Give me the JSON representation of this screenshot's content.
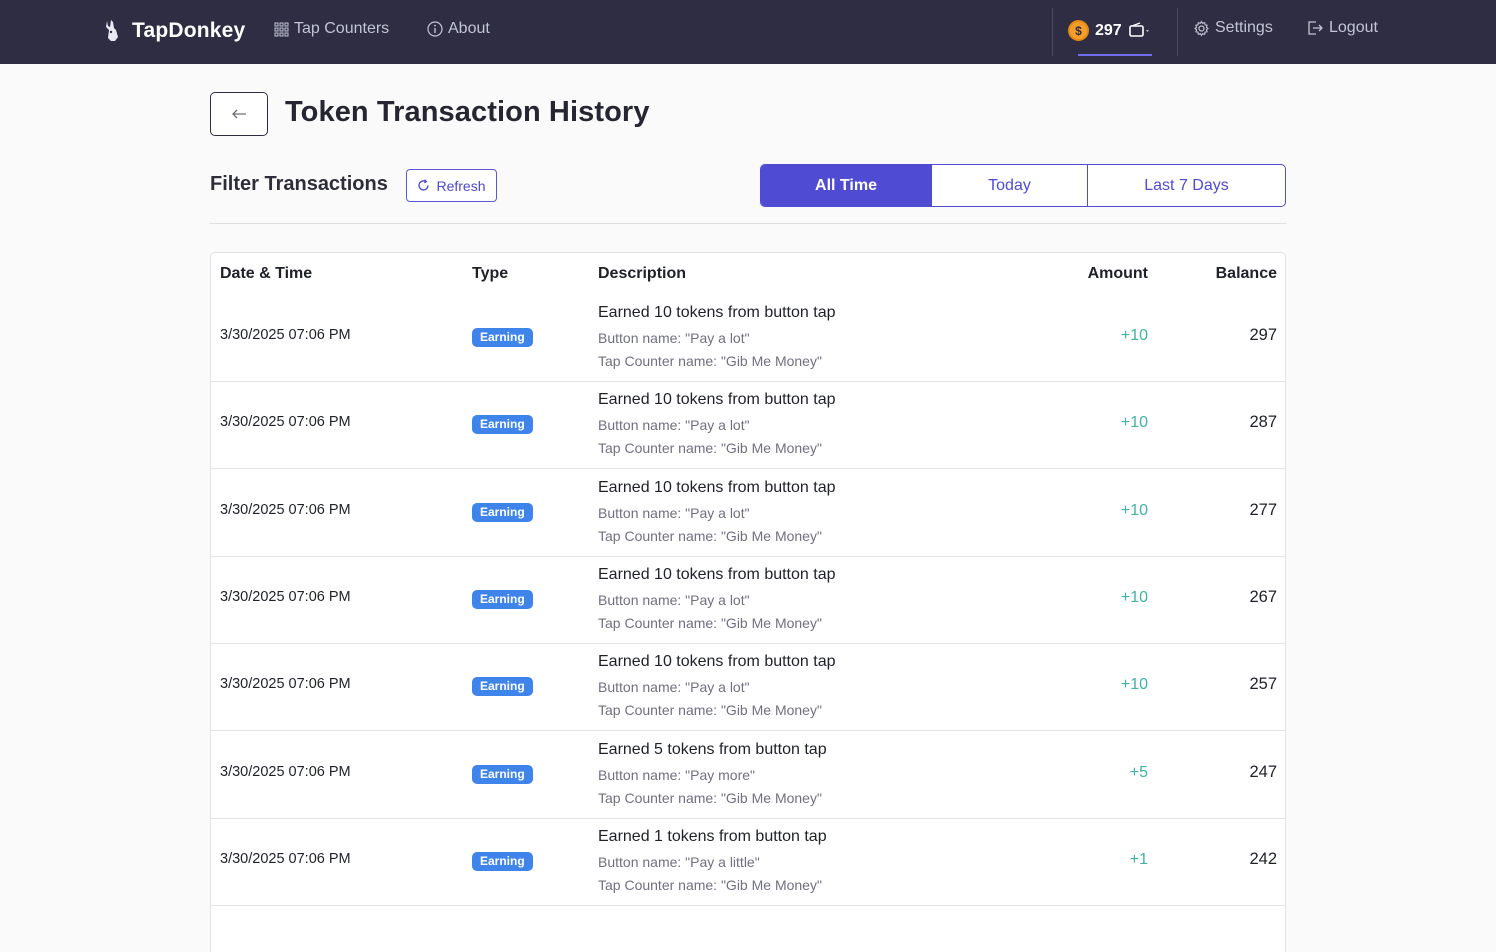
{
  "nav": {
    "brand": "TapDonkey",
    "tap_counters": "Tap Counters",
    "about": "About",
    "wallet_amount": "297",
    "settings": "Settings",
    "logout": "Logout"
  },
  "header": {
    "title": "Token Transaction History"
  },
  "filter": {
    "title": "Filter Transactions",
    "refresh": "Refresh",
    "options": [
      "All Time",
      "Today",
      "Last 7 Days"
    ],
    "selected": "All Time"
  },
  "table": {
    "columns": [
      "Date & Time",
      "Type",
      "Description",
      "Amount",
      "Balance"
    ],
    "rows": [
      {
        "date": "3/30/2025 07:06 PM",
        "type": "Earning",
        "desc": "Earned 10 tokens from button tap",
        "button": "Button name: \"Pay a lot\"",
        "counter": "Tap Counter name: \"Gib Me Money\"",
        "amount": "+10",
        "balance": "297"
      },
      {
        "date": "3/30/2025 07:06 PM",
        "type": "Earning",
        "desc": "Earned 10 tokens from button tap",
        "button": "Button name: \"Pay a lot\"",
        "counter": "Tap Counter name: \"Gib Me Money\"",
        "amount": "+10",
        "balance": "287"
      },
      {
        "date": "3/30/2025 07:06 PM",
        "type": "Earning",
        "desc": "Earned 10 tokens from button tap",
        "button": "Button name: \"Pay a lot\"",
        "counter": "Tap Counter name: \"Gib Me Money\"",
        "amount": "+10",
        "balance": "277"
      },
      {
        "date": "3/30/2025 07:06 PM",
        "type": "Earning",
        "desc": "Earned 10 tokens from button tap",
        "button": "Button name: \"Pay a lot\"",
        "counter": "Tap Counter name: \"Gib Me Money\"",
        "amount": "+10",
        "balance": "267"
      },
      {
        "date": "3/30/2025 07:06 PM",
        "type": "Earning",
        "desc": "Earned 10 tokens from button tap",
        "button": "Button name: \"Pay a lot\"",
        "counter": "Tap Counter name: \"Gib Me Money\"",
        "amount": "+10",
        "balance": "257"
      },
      {
        "date": "3/30/2025 07:06 PM",
        "type": "Earning",
        "desc": "Earned 5 tokens from button tap",
        "button": "Button name: \"Pay more\"",
        "counter": "Tap Counter name: \"Gib Me Money\"",
        "amount": "+5",
        "balance": "247"
      },
      {
        "date": "3/30/2025 07:06 PM",
        "type": "Earning",
        "desc": "Earned 1 tokens from button tap",
        "button": "Button name: \"Pay a little\"",
        "counter": "Tap Counter name: \"Gib Me Money\"",
        "amount": "+1",
        "balance": "242"
      }
    ]
  },
  "colors": {
    "navbar": "#2e2d44",
    "accent": "#4f4bd3",
    "badge": "#3f84ea",
    "positive_amount": "#3db4a4",
    "coin": "#f59e2c"
  },
  "icons": {
    "brand": "donkey-icon",
    "tap_counters": "grid-icon",
    "about": "info-icon",
    "wallet": "wallet-icon",
    "settings": "gear-icon",
    "logout": "logout-icon",
    "back": "arrow-left-icon",
    "refresh": "refresh-icon"
  }
}
